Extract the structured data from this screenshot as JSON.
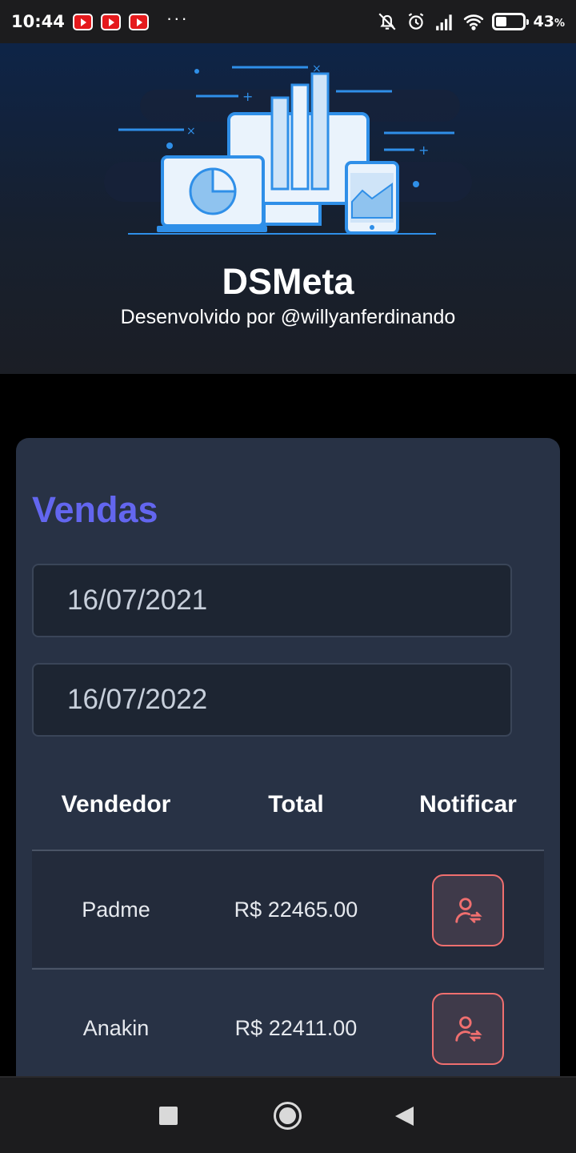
{
  "status_bar": {
    "time": "10:44",
    "battery_percent": "43",
    "battery_unit": "%",
    "battery_level": 0.43,
    "notification_icons": [
      "youtube-icon",
      "youtube-icon",
      "youtube-icon"
    ],
    "overflow": "···"
  },
  "header": {
    "title": "DSMeta",
    "subtitle": "Desenvolvido por @willyanferdinando"
  },
  "sales": {
    "title": "Vendas",
    "date_from": "16/07/2021",
    "date_to": "16/07/2022",
    "columns": [
      "Vendedor",
      "Total",
      "Notificar"
    ],
    "rows": [
      {
        "seller": "Padme",
        "total": "R$ 22465.00"
      },
      {
        "seller": "Anakin",
        "total": "R$ 22411.00"
      }
    ]
  },
  "colors": {
    "accent": "#6366ef",
    "card": "#283245",
    "notify_border": "#f06f6f"
  }
}
